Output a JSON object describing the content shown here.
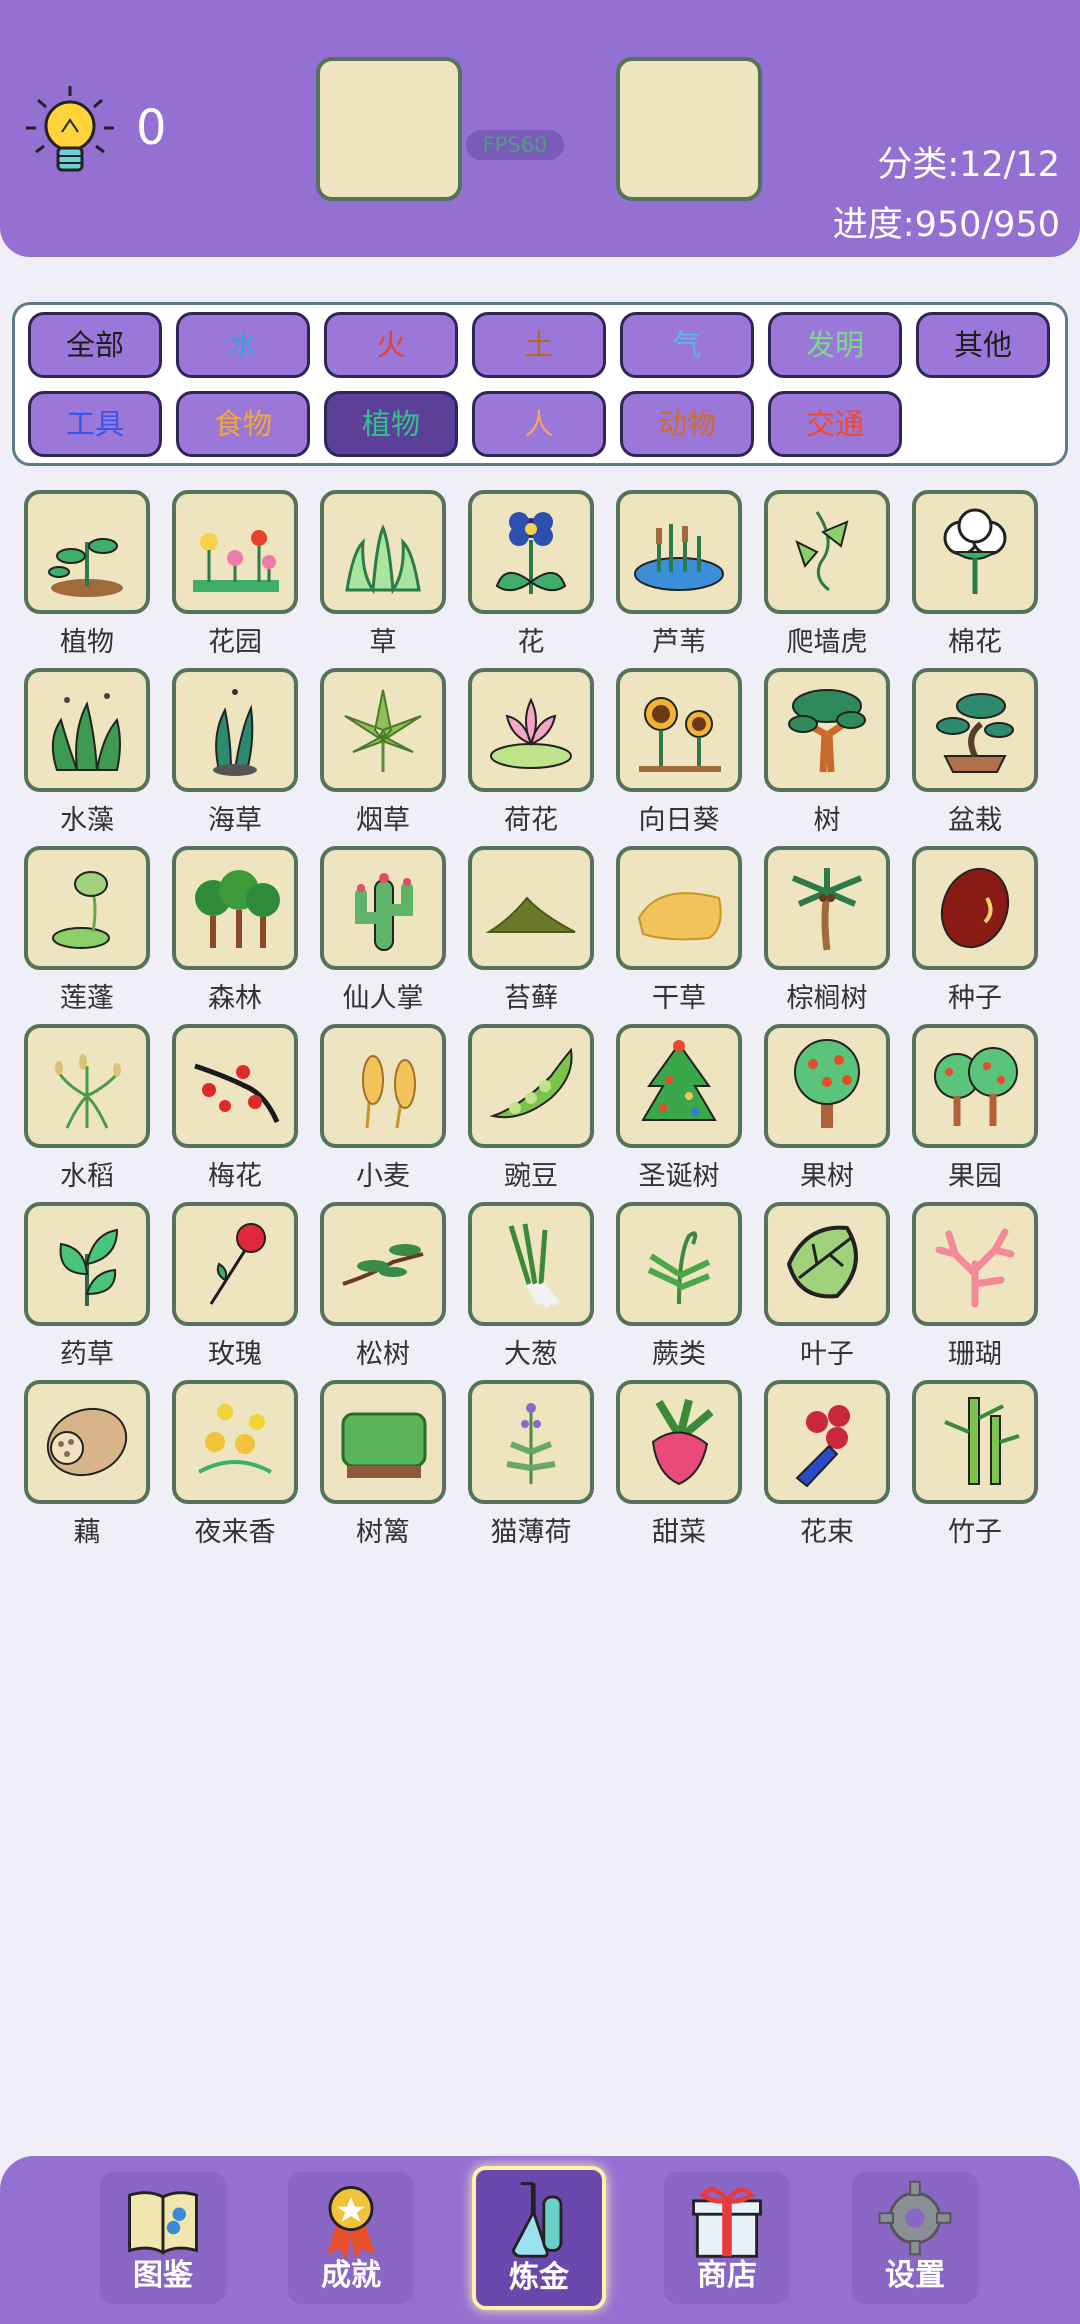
{
  "header": {
    "hint_count": "0",
    "fps": "FPS60",
    "category_count": "分类:12/12",
    "progress": "进度:950/950"
  },
  "filters": [
    {
      "label": "全部",
      "color": "#1e1e1e",
      "active": false
    },
    {
      "label": "水",
      "color": "#3a9fe0",
      "active": false
    },
    {
      "label": "火",
      "color": "#e8402a",
      "active": false
    },
    {
      "label": "土",
      "color": "#b06a2a",
      "active": false
    },
    {
      "label": "气",
      "color": "#5fb4f0",
      "active": false
    },
    {
      "label": "发明",
      "color": "#7bd98b",
      "active": false
    },
    {
      "label": "其他",
      "color": "#1e1e1e",
      "active": false
    },
    {
      "label": "工具",
      "color": "#3b55e6",
      "active": false
    },
    {
      "label": "食物",
      "color": "#f2a93a",
      "active": false
    },
    {
      "label": "植物",
      "color": "#35c08e",
      "active": true
    },
    {
      "label": "人",
      "color": "#f0a66a",
      "active": false
    },
    {
      "label": "动物",
      "color": "#d56b2a",
      "active": false
    },
    {
      "label": "交通",
      "color": "#f04a2a",
      "active": false
    }
  ],
  "items": [
    {
      "name": "植物",
      "icon": "plant-sprout-icon"
    },
    {
      "name": "花园",
      "icon": "garden-icon"
    },
    {
      "name": "草",
      "icon": "grass-icon"
    },
    {
      "name": "花",
      "icon": "flower-icon"
    },
    {
      "name": "芦苇",
      "icon": "reed-icon"
    },
    {
      "name": "爬墙虎",
      "icon": "ivy-icon"
    },
    {
      "name": "棉花",
      "icon": "cotton-icon"
    },
    {
      "name": "水藻",
      "icon": "algae-icon"
    },
    {
      "name": "海草",
      "icon": "seaweed-icon"
    },
    {
      "name": "烟草",
      "icon": "tobacco-leaf-icon"
    },
    {
      "name": "荷花",
      "icon": "lotus-icon"
    },
    {
      "name": "向日葵",
      "icon": "sunflower-icon"
    },
    {
      "name": "树",
      "icon": "tree-icon"
    },
    {
      "name": "盆栽",
      "icon": "bonsai-icon"
    },
    {
      "name": "莲蓬",
      "icon": "lotus-pod-icon"
    },
    {
      "name": "森林",
      "icon": "forest-icon"
    },
    {
      "name": "仙人掌",
      "icon": "cactus-icon"
    },
    {
      "name": "苔藓",
      "icon": "moss-icon"
    },
    {
      "name": "干草",
      "icon": "hay-icon"
    },
    {
      "name": "棕榈树",
      "icon": "palm-tree-icon"
    },
    {
      "name": "种子",
      "icon": "seed-icon"
    },
    {
      "name": "水稻",
      "icon": "rice-icon"
    },
    {
      "name": "梅花",
      "icon": "plum-blossom-icon"
    },
    {
      "name": "小麦",
      "icon": "wheat-icon"
    },
    {
      "name": "豌豆",
      "icon": "pea-icon"
    },
    {
      "name": "圣诞树",
      "icon": "christmas-tree-icon"
    },
    {
      "name": "果树",
      "icon": "fruit-tree-icon"
    },
    {
      "name": "果园",
      "icon": "orchard-icon"
    },
    {
      "name": "药草",
      "icon": "herb-icon"
    },
    {
      "name": "玫瑰",
      "icon": "rose-icon"
    },
    {
      "name": "松树",
      "icon": "pine-tree-icon"
    },
    {
      "name": "大葱",
      "icon": "scallion-icon"
    },
    {
      "name": "蕨类",
      "icon": "fern-icon"
    },
    {
      "name": "叶子",
      "icon": "leaf-icon"
    },
    {
      "name": "珊瑚",
      "icon": "coral-icon"
    },
    {
      "name": "藕",
      "icon": "lotus-root-icon"
    },
    {
      "name": "夜来香",
      "icon": "night-jasmine-icon"
    },
    {
      "name": "树篱",
      "icon": "hedge-icon"
    },
    {
      "name": "猫薄荷",
      "icon": "catnip-icon"
    },
    {
      "name": "甜菜",
      "icon": "beet-icon"
    },
    {
      "name": "花束",
      "icon": "bouquet-icon"
    },
    {
      "name": "竹子",
      "icon": "bamboo-icon"
    }
  ],
  "nav": [
    {
      "label": "图鉴",
      "icon": "book-icon",
      "active": false
    },
    {
      "label": "成就",
      "icon": "medal-icon",
      "active": false
    },
    {
      "label": "炼金",
      "icon": "flask-icon",
      "active": true
    },
    {
      "label": "商店",
      "icon": "gift-icon",
      "active": false
    },
    {
      "label": "设置",
      "icon": "gear-icon",
      "active": false
    }
  ]
}
